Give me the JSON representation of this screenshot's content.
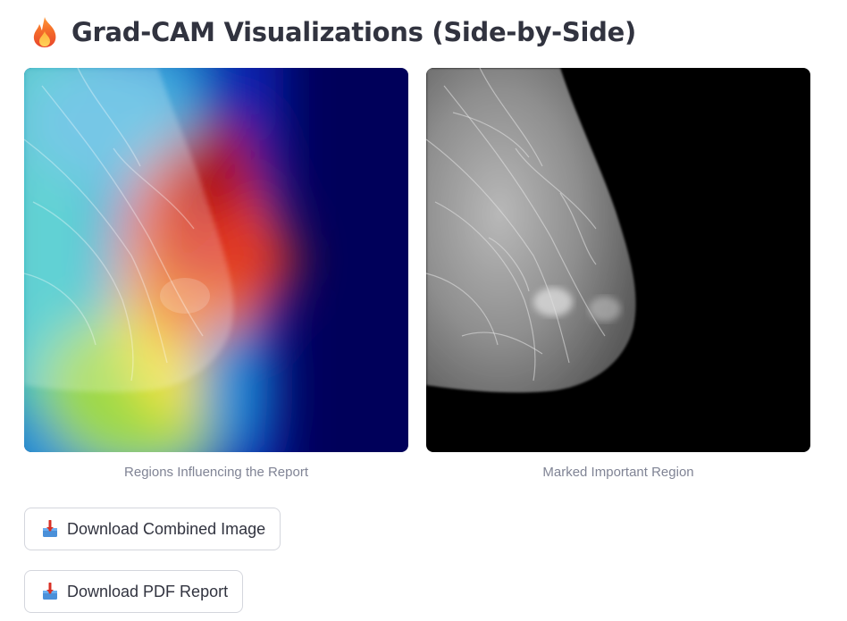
{
  "header": {
    "icon": "fire-icon",
    "title": "Grad-CAM Visualizations (Side-by-Side)"
  },
  "images": {
    "left": {
      "caption": "Regions Influencing the Report",
      "kind": "grad-cam-heatmap-overlay"
    },
    "right": {
      "caption": "Marked Important Region",
      "kind": "grayscale-mammogram"
    }
  },
  "buttons": {
    "combined": {
      "label": "Download Combined Image",
      "icon": "download-inbox-icon"
    },
    "pdf": {
      "label": "Download PDF Report",
      "icon": "download-inbox-icon"
    }
  },
  "colors": {
    "text": "#31333f",
    "caption": "#808495",
    "button_border": "#d4d6dd",
    "heatmap_background": "#00005a"
  }
}
